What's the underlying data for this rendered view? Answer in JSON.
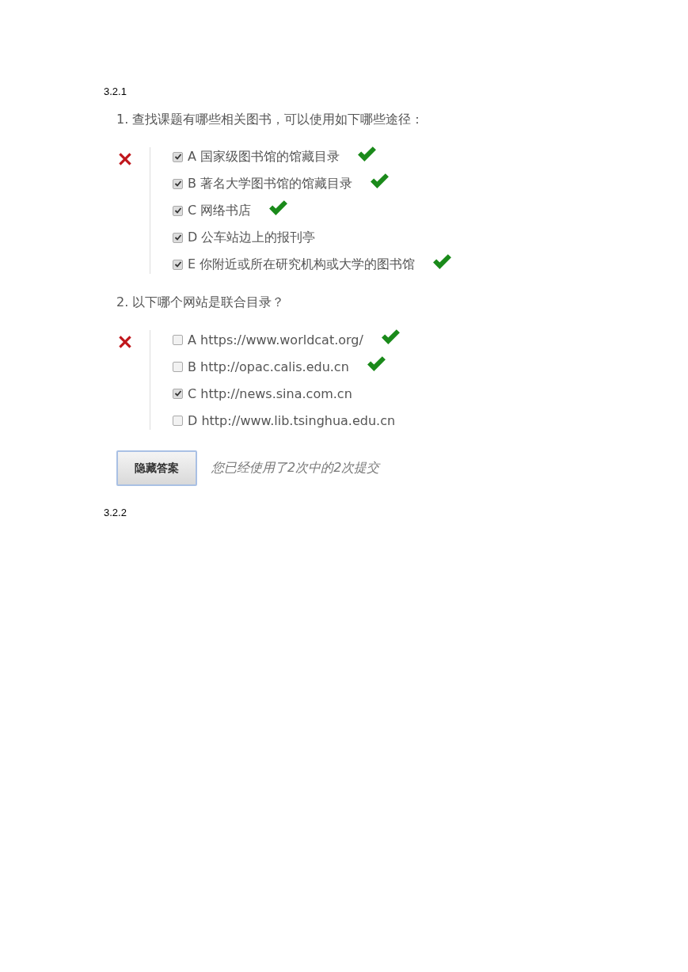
{
  "headings": [
    "3.2.1",
    "3.2.2"
  ],
  "questions": [
    {
      "text": "1. 查找课题有哪些相关图书，可以使用如下哪些途径：",
      "correct": false,
      "options": [
        {
          "letter": "A",
          "text": "国家级图书馆的馆藏目录",
          "checked": true,
          "correct": true
        },
        {
          "letter": "B",
          "text": "著名大学图书馆的馆藏目录",
          "checked": true,
          "correct": true
        },
        {
          "letter": "C",
          "text": "网络书店",
          "checked": true,
          "correct": true
        },
        {
          "letter": "D",
          "text": "公车站边上的报刊亭",
          "checked": true,
          "correct": false
        },
        {
          "letter": "E",
          "text": "你附近或所在研究机构或大学的图书馆",
          "checked": true,
          "correct": true
        }
      ]
    },
    {
      "text": "2. 以下哪个网站是联合目录？",
      "correct": false,
      "options": [
        {
          "letter": "A",
          "text": "https://www.worldcat.org/",
          "checked": false,
          "correct": true
        },
        {
          "letter": "B",
          "text": "http://opac.calis.edu.cn",
          "checked": false,
          "correct": true
        },
        {
          "letter": "C",
          "text": "http://news.sina.com.cn",
          "checked": true,
          "correct": false
        },
        {
          "letter": "D",
          "text": "http://www.lib.tsinghua.edu.cn",
          "checked": false,
          "correct": false
        }
      ]
    }
  ],
  "button": "隐藏答案",
  "status": "您已经使用了2次中的2次提交"
}
